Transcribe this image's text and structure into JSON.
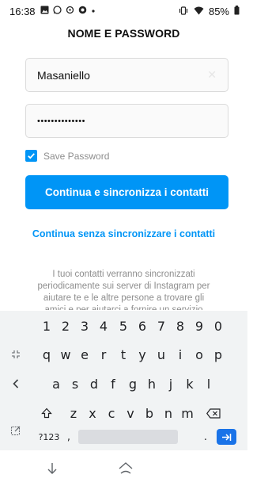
{
  "status_bar": {
    "time": "16:38",
    "battery": "85%",
    "icons": [
      "image-icon",
      "whatsapp-icon",
      "sync-icon",
      "chrome-icon",
      "dot-icon"
    ]
  },
  "page": {
    "title": "NOME E PASSWORD"
  },
  "form": {
    "username_value": "Masaniello",
    "password_value": "••••••••••••••",
    "save_password_label": "Save Password",
    "save_password_checked": true,
    "primary_button_label": "Continua e sincronizza i contatti",
    "secondary_link_label": "Continua senza sincronizzare i contatti",
    "info_text": "I tuoi contatti verranno sincronizzati periodicamente sui server di Instagram per aiutare te e le altre persone a trovare gli amici e per aiutarci a fornire un servizio migliore. Per"
  },
  "keyboard": {
    "numbers": [
      "1",
      "2",
      "3",
      "4",
      "5",
      "6",
      "7",
      "8",
      "9",
      "0"
    ],
    "row1": [
      "q",
      "w",
      "e",
      "r",
      "t",
      "y",
      "u",
      "i",
      "o",
      "p"
    ],
    "row2": [
      "a",
      "s",
      "d",
      "f",
      "g",
      "h",
      "j",
      "k",
      "l"
    ],
    "row3": [
      "z",
      "x",
      "c",
      "v",
      "b",
      "n",
      "m"
    ],
    "mode_key": "?123",
    "comma_key": ",",
    "period_key": "."
  },
  "colors": {
    "accent": "#0095f6",
    "text_dark": "#111111",
    "text_muted": "#8e8e8e",
    "keyboard_bg": "#f1f3f4"
  }
}
